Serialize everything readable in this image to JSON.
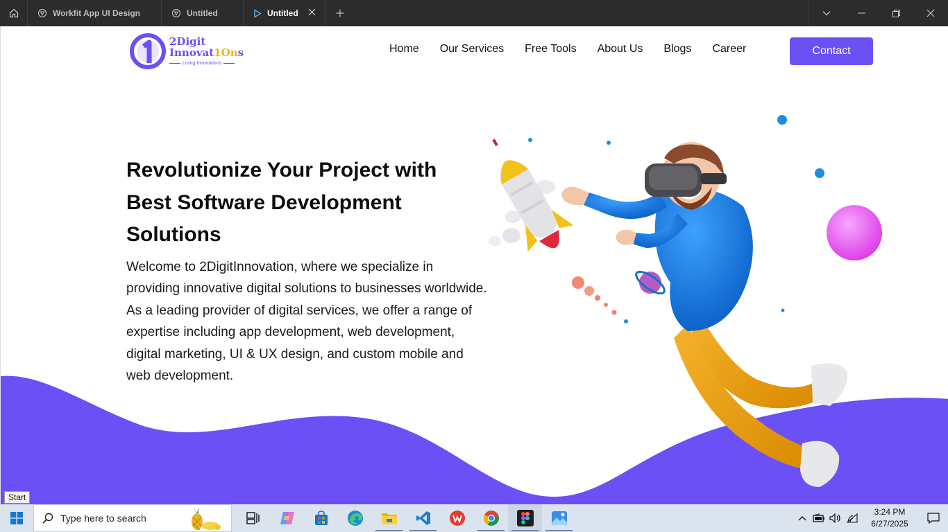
{
  "tabs": [
    {
      "label": "Workfit App UI Design",
      "icon": "figma-file-icon"
    },
    {
      "label": "Untitled",
      "icon": "figma-file-icon"
    },
    {
      "label": "Untitled",
      "icon": "prototype-play-icon",
      "active": true
    }
  ],
  "site": {
    "logo": {
      "line1": "2Digit",
      "line2a": "Innovat",
      "line2b": "1On",
      "line2c": "s",
      "tagline": "Living Innovations"
    },
    "nav": [
      "Home",
      "Our Services",
      "Free Tools",
      "About Us",
      "Blogs",
      "Career"
    ],
    "contact_label": "Contact",
    "hero_title": "Revolutionize Your Project with Best Software Development Solutions",
    "hero_text": "Welcome to 2DigitInnovation, where we specialize in providing innovative digital solutions to businesses worldwide. As a leading provider of digital services, we offer a range of expertise including app development, web development, digital marketing, UI & UX design, and custom mobile and web development."
  },
  "colors": {
    "brand": "#6a50f5",
    "accent": "#f2b21b",
    "titlebar": "#2c2c2c",
    "taskbar": "#dbe3ee"
  },
  "tooltip": "Start",
  "taskbar": {
    "search_placeholder": "Type here to search",
    "apps": [
      "task-view-icon",
      "copilot-icon",
      "store-icon",
      "edge-icon",
      "file-explorer-icon",
      "vscode-icon",
      "wps-icon",
      "chrome-icon",
      "figma-icon",
      "photos-icon"
    ],
    "time": "3:24 PM",
    "date": "6/27/2025"
  }
}
